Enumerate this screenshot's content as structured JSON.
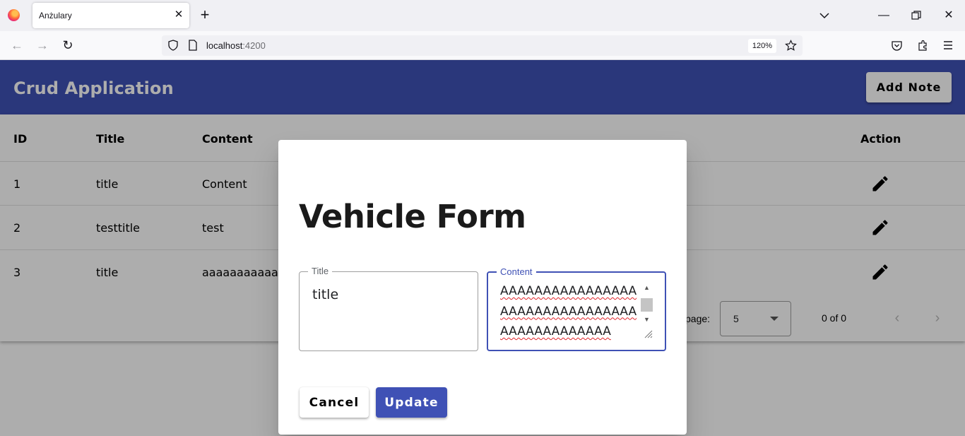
{
  "browser": {
    "tab_title": "Anżulary",
    "url_host": "localhost",
    "url_port": ":4200",
    "zoom": "120%"
  },
  "app": {
    "title": "Crud Application",
    "add_button": "Add Note",
    "accent": "#3f51b5"
  },
  "table": {
    "columns": [
      "ID",
      "Title",
      "Content",
      "Action"
    ],
    "rows": [
      {
        "id": "1",
        "title": "title",
        "content": "Content"
      },
      {
        "id": "2",
        "title": "testtitle",
        "content": "test"
      },
      {
        "id": "3",
        "title": "title",
        "content": "aaaaaaaaaaaa"
      }
    ],
    "paginator": {
      "label": "page:",
      "page_size": "5",
      "range": "0 of 0"
    }
  },
  "dialog": {
    "title": "Vehicle Form",
    "title_field": {
      "label": "Title",
      "value": "title"
    },
    "content_field": {
      "label": "Content",
      "value": "AAAAAAAAAAAAAAAAAAAAAAAAAAAAAAAAAAAAAAAAAAAAA"
    },
    "cancel_label": "Cancel",
    "update_label": "Update"
  }
}
